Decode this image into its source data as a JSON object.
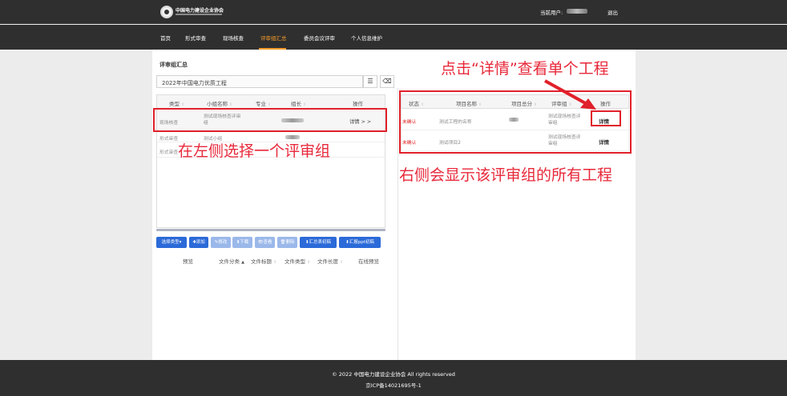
{
  "header": {
    "brand": "中国电力建设企业协会",
    "user_label": "当前用户:",
    "logout": "退出"
  },
  "nav": {
    "items": [
      "首页",
      "形式审查",
      "现场核查",
      "评审组汇总",
      "委员会议评审",
      "个人信息维护"
    ],
    "active": "评审组汇总"
  },
  "page": {
    "title": "评审组汇总",
    "project_select": "2022年中国电力优质工程",
    "menu_icon": "☰",
    "clear_icon": "⌫"
  },
  "left_table": {
    "columns": [
      "类型",
      "小组名称",
      "专业",
      "组长",
      "操作"
    ],
    "rows": [
      {
        "type": "现场核查",
        "group": "测试现场核查评审组",
        "action": "详情 > >"
      },
      {
        "type": "形式审查",
        "group": "测试小组"
      },
      {
        "type": "形式审查"
      }
    ]
  },
  "toolbar": {
    "select_type": "选择类型▾",
    "add": "✚添加",
    "edit": "✎修改",
    "download": "⬇下载",
    "view": "👁查看",
    "delete": "🗑删除",
    "summary_draft": "⬇汇总表初稿",
    "ppt_draft": "⬇汇报ppt初稿"
  },
  "file_table": {
    "columns": [
      "预览",
      "文件分类",
      "文件标题",
      "文件类型",
      "文件长度",
      "在线预览"
    ]
  },
  "right_table": {
    "columns": [
      "状态",
      "项目名称",
      "项目总分",
      "评审组",
      "操作"
    ],
    "rows": [
      {
        "status": "未确认",
        "name": "测试工程的名称",
        "group": "测试现场核查评审组",
        "action": "详情"
      },
      {
        "status": "未确认",
        "name": "测试项目2",
        "group": "测试现场核查评审组",
        "action": "详情"
      }
    ]
  },
  "annotations": {
    "left": "在左侧选择一个评审组",
    "right": "右侧会显示该评审组的所有工程",
    "top": "点击“详情”查看单个工程"
  },
  "footer": {
    "copyright": "© 2022 中国电力建设企业协会 All rights reserved",
    "icp": "京ICP备14021695号-1"
  },
  "colors": {
    "header_bg": "#2f2f2f",
    "nav_active": "#f39b2a",
    "primary_btn": "#2b6ad8",
    "annotation": "#e0202a",
    "status_unconfirmed": "#e02020"
  }
}
